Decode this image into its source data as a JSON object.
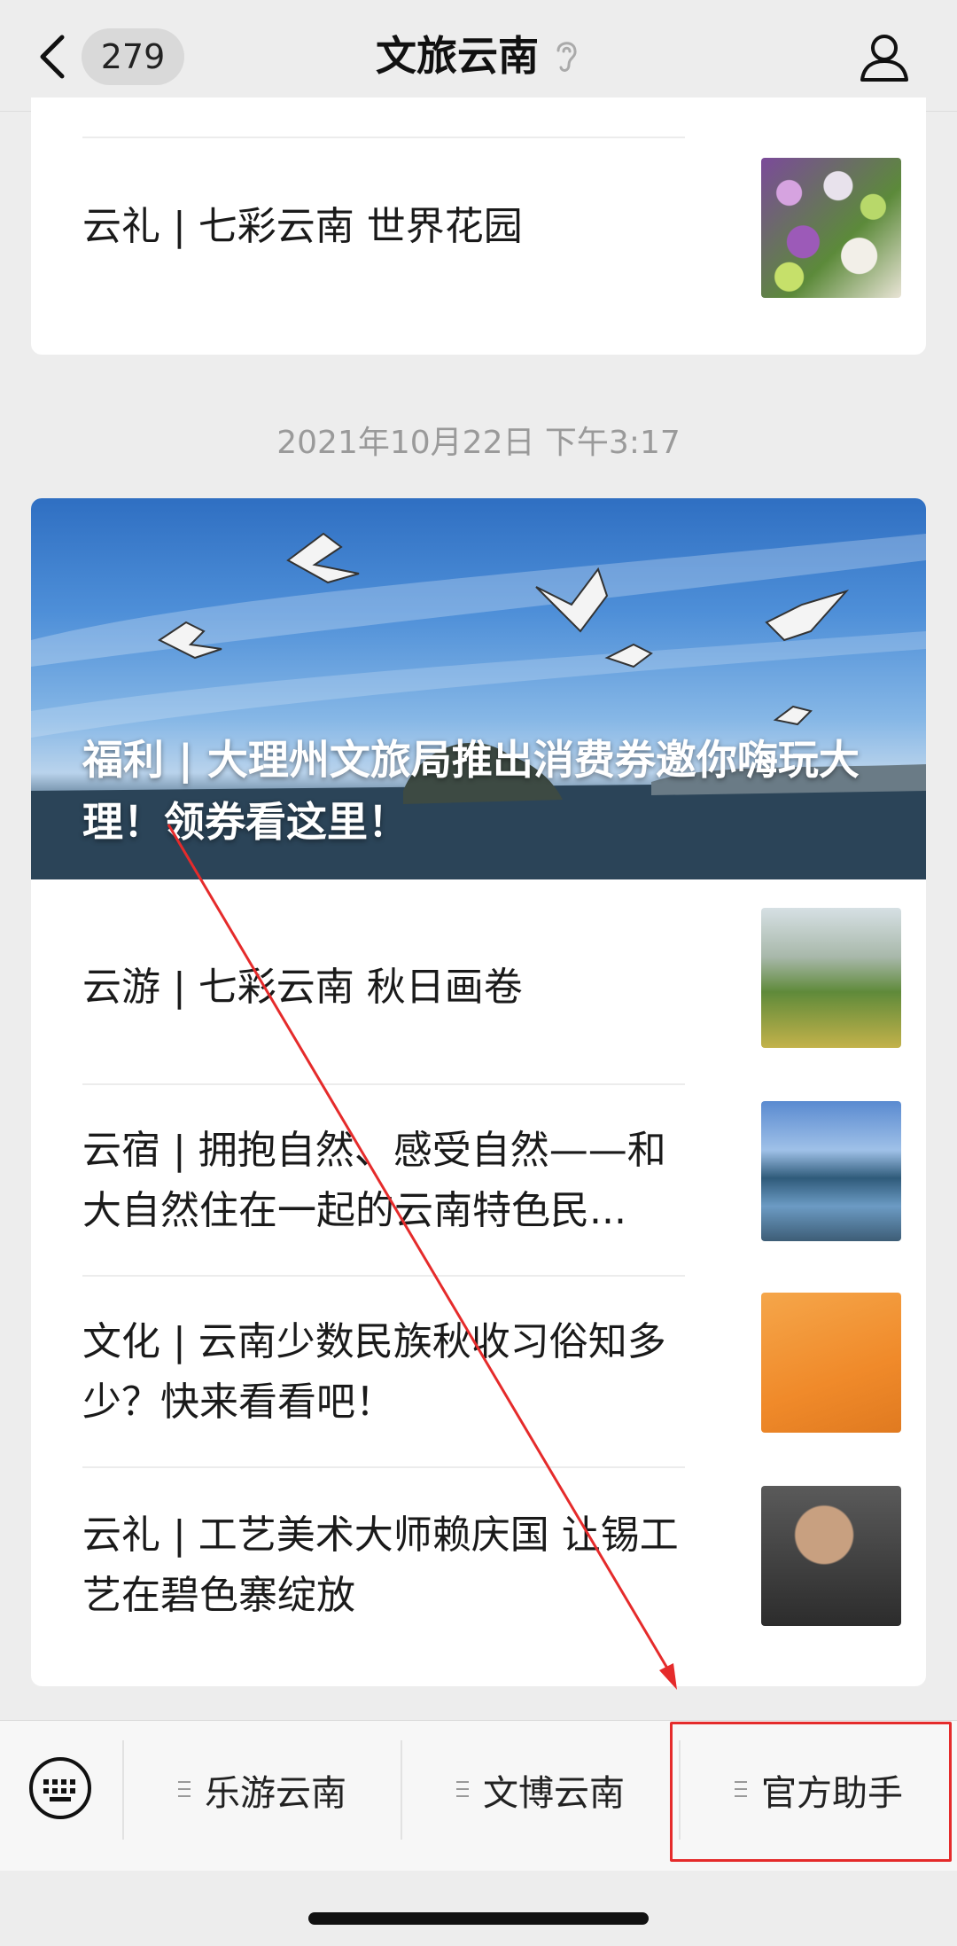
{
  "header": {
    "badge_count": "279",
    "title": "文旅云南"
  },
  "feed": {
    "first_card": {
      "items": [
        {
          "title": "云礼 | 七彩云南 世界花园"
        }
      ]
    },
    "timestamp": "2021年10月22日 下午3:17",
    "second_card": {
      "hero_title": "福利 | 大理州文旅局推出消费券邀你嗨玩大理！领券看这里！",
      "items": [
        {
          "title": "云游 | 七彩云南 秋日画卷"
        },
        {
          "title": "云宿 | 拥抱自然、感受自然——和大自然住在一起的云南特色民..."
        },
        {
          "title": "文化 | 云南少数民族秋收习俗知多少？快来看看吧！"
        },
        {
          "title": "云礼 | 工艺美术大师赖庆国 让锡工艺在碧色寨绽放"
        }
      ]
    }
  },
  "menu": {
    "items": [
      {
        "label": "乐游云南"
      },
      {
        "label": "文博云南"
      },
      {
        "label": "官方助手"
      }
    ]
  },
  "colors": {
    "annotation": "#e52b2b",
    "background": "#ededed"
  },
  "icons": [
    "back-arrow-icon",
    "ear-icon",
    "profile-icon",
    "keyboard-icon",
    "menu-lines-icon"
  ]
}
